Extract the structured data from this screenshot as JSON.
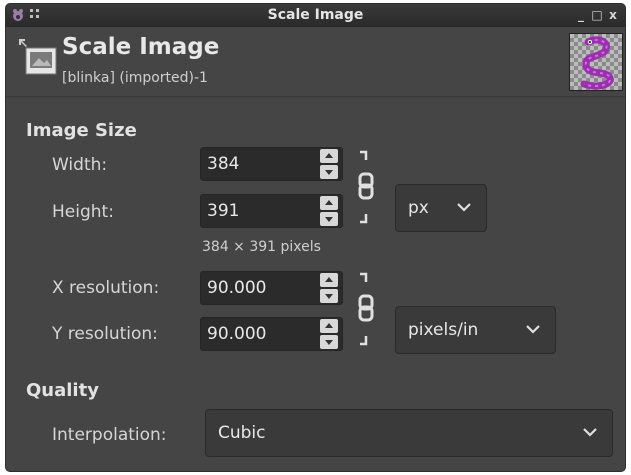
{
  "window": {
    "title": "Scale Image",
    "buttons": {
      "minimize": "_",
      "maximize": "□",
      "close": "x"
    }
  },
  "header": {
    "title": "Scale Image",
    "subtitle": "[blinka] (imported)-1",
    "icon": "scale-image-icon",
    "thumbnail": "image-thumbnail"
  },
  "image_size": {
    "section_title": "Image Size",
    "width": {
      "label": "Width:",
      "value": "384"
    },
    "height": {
      "label": "Height:",
      "value": "391"
    },
    "unit": "px",
    "pixels_note": "384 × 391 pixels",
    "chain_linked": true
  },
  "resolution": {
    "x": {
      "label": "X resolution:",
      "value": "90.000"
    },
    "y": {
      "label": "Y resolution:",
      "value": "90.000"
    },
    "unit": "pixels/in",
    "chain_linked": true
  },
  "quality": {
    "section_title": "Quality",
    "interpolation": {
      "label": "Interpolation:",
      "value": "Cubic"
    }
  },
  "colors": {
    "background": "#454545",
    "field": "#2b2b2b",
    "titlebar": "#2a2a2a"
  }
}
